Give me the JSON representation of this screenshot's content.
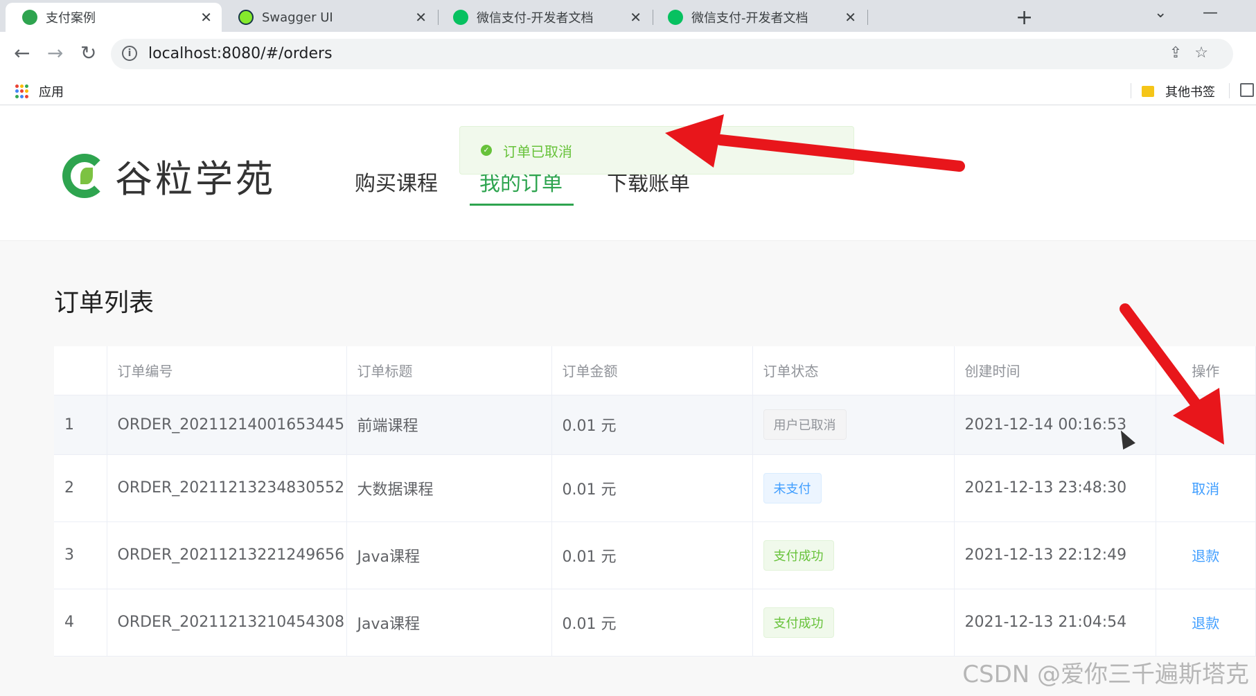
{
  "tabs": [
    {
      "title": "支付案例",
      "active": true,
      "favicon_color": "#2ea44f"
    },
    {
      "title": "Swagger UI",
      "active": false,
      "favicon_color": "#85ea2d"
    },
    {
      "title": "微信支付-开发者文档",
      "active": false,
      "favicon_color": "#07c160"
    },
    {
      "title": "微信支付-开发者文档",
      "active": false,
      "favicon_color": "#07c160"
    }
  ],
  "address_bar": {
    "url": "localhost:8080/#/orders"
  },
  "bookmarks": {
    "apps_label": "应用",
    "other_label": "其他书签"
  },
  "site": {
    "logo_text": "谷粒学苑",
    "nav": [
      {
        "label": "购买课程",
        "active": false
      },
      {
        "label": "我的订单",
        "active": true
      },
      {
        "label": "下载账单",
        "active": false
      }
    ]
  },
  "toast": {
    "message": "订单已取消",
    "type": "success"
  },
  "orders": {
    "title": "订单列表",
    "columns": [
      "",
      "订单编号",
      "订单标题",
      "订单金额",
      "订单状态",
      "创建时间",
      "操作"
    ],
    "rows": [
      {
        "index": "1",
        "order_no": "ORDER_20211214001653445",
        "title": "前端课程",
        "amount": "0.01 元",
        "status": "用户已取消",
        "status_type": "info",
        "created": "2021-12-14 00:16:53",
        "action": ""
      },
      {
        "index": "2",
        "order_no": "ORDER_20211213234830552",
        "title": "大数据课程",
        "amount": "0.01 元",
        "status": "未支付",
        "status_type": "primary",
        "created": "2021-12-13 23:48:30",
        "action": "取消"
      },
      {
        "index": "3",
        "order_no": "ORDER_20211213221249656",
        "title": "Java课程",
        "amount": "0.01 元",
        "status": "支付成功",
        "status_type": "success",
        "created": "2021-12-13 22:12:49",
        "action": "退款"
      },
      {
        "index": "4",
        "order_no": "ORDER_20211213210454308",
        "title": "Java课程",
        "amount": "0.01 元",
        "status": "支付成功",
        "status_type": "success",
        "created": "2021-12-13 21:04:54",
        "action": "退款"
      }
    ]
  },
  "watermark": "CSDN @爱你三千遍斯塔克",
  "colors": {
    "brand_green": "#2ea44f",
    "link_blue": "#409eff",
    "annotation_red": "#e8161b"
  }
}
